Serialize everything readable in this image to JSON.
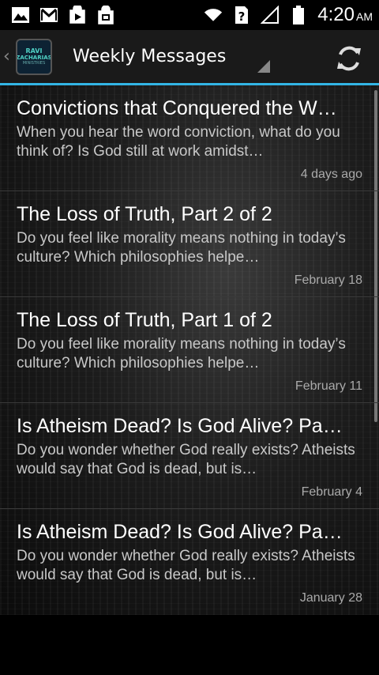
{
  "status_bar": {
    "left_icons": [
      "image-icon",
      "gmail-icon",
      "play-store-icon",
      "shopping-bag-icon"
    ],
    "right_icons": [
      "wifi-icon",
      "sim-unknown-icon",
      "signal-icon",
      "battery-icon"
    ],
    "time": "4:20",
    "ampm": "AM"
  },
  "action_bar": {
    "logo_text_1": "RAVI",
    "logo_text_2": "ZACHARIAS",
    "logo_text_3": "MINISTRIES",
    "title": "Weekly Messages",
    "refresh_icon": "refresh-icon",
    "accent_color": "#33b5e5"
  },
  "messages": [
    {
      "title": "Convictions that Conquered the W…",
      "description": "When you hear the word conviction, what do you think of? Is God still at work amidst…",
      "date": "4 days ago"
    },
    {
      "title": "The Loss of Truth, Part 2 of 2",
      "description": "Do you feel like morality means nothing in today’s culture? Which philosophies helpe…",
      "date": "February 18"
    },
    {
      "title": "The Loss of Truth, Part 1 of 2",
      "description": "Do you feel like morality means nothing in today’s culture? Which philosophies helpe…",
      "date": "February 11"
    },
    {
      "title": "Is Atheism Dead? Is God Alive? Pa…",
      "description": "Do you wonder whether God really exists? Atheists would say that God is dead, but is…",
      "date": "February 4"
    },
    {
      "title": "Is Atheism Dead? Is God Alive? Pa…",
      "description": "Do you wonder whether God really exists? Atheists would say that God is dead, but is…",
      "date": "January 28"
    }
  ]
}
